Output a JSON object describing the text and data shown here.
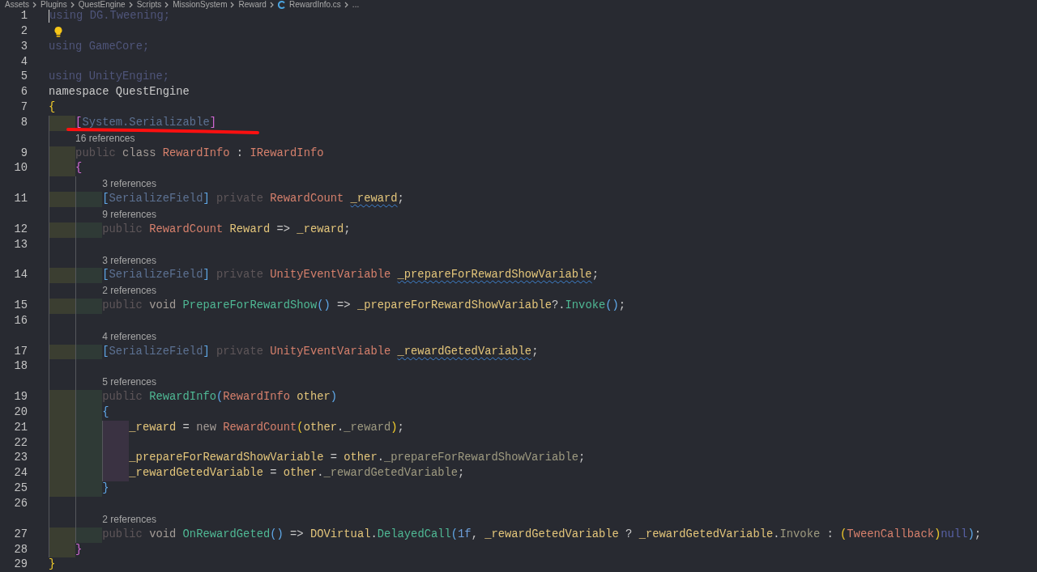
{
  "breadcrumbs": [
    {
      "label": "Assets",
      "kind": "folder"
    },
    {
      "label": "Plugins",
      "kind": "folder"
    },
    {
      "label": "QuestEngine",
      "kind": "folder"
    },
    {
      "label": "Scripts",
      "kind": "folder"
    },
    {
      "label": "MissionSystem",
      "kind": "folder"
    },
    {
      "label": "Reward",
      "kind": "folder"
    },
    {
      "label": "RewardInfo.cs",
      "kind": "file"
    },
    {
      "label": "...",
      "kind": "more"
    }
  ],
  "lines": [
    {
      "number": "1",
      "cursor": true,
      "tokens": [
        {
          "text": "using DG.Tweening;",
          "kind": "unused"
        }
      ]
    },
    {
      "number": "2",
      "lightbulb": true
    },
    {
      "number": "3",
      "tokens": [
        {
          "text": "using GameCore;",
          "kind": "unused"
        }
      ]
    },
    {
      "number": "4"
    },
    {
      "number": "5",
      "tokens": [
        {
          "text": "using UnityEngine;",
          "kind": "unused"
        }
      ]
    },
    {
      "number": "6",
      "tokens": [
        {
          "text": "namespace QuestEngine",
          "kind": "plain"
        }
      ]
    },
    {
      "number": "7",
      "tokens": [
        {
          "text": "{",
          "kind": "brace1"
        }
      ]
    },
    {
      "number": "8",
      "underlined": true,
      "guides": [
        {
          "shaded": true
        }
      ],
      "tokens": [
        {
          "text": "[",
          "kind": "brace2"
        },
        {
          "text": "System.Serializable",
          "kind": "attribute"
        },
        {
          "text": "]",
          "kind": "brace2"
        }
      ]
    },
    {
      "number": "9",
      "lens": "16 references",
      "guides": [
        {
          "shaded": true
        }
      ],
      "tokens": [
        {
          "text": "public ",
          "kind": "modifier"
        },
        {
          "text": "class ",
          "kind": "keyword"
        },
        {
          "text": "RewardInfo",
          "kind": "type"
        },
        {
          "text": " : ",
          "kind": "plain"
        },
        {
          "text": "IRewardInfo",
          "kind": "type"
        }
      ]
    },
    {
      "number": "10",
      "guides": [
        {
          "shaded": true
        }
      ],
      "tokens": [
        {
          "text": "{",
          "kind": "brace2"
        }
      ]
    },
    {
      "number": "11",
      "lens": "3 references",
      "guides": [
        {
          "shaded": true
        },
        {
          "shaded": true
        }
      ],
      "tokens": [
        {
          "text": "[",
          "kind": "brace3"
        },
        {
          "text": "SerializeField",
          "kind": "attribute"
        },
        {
          "text": "]",
          "kind": "brace3"
        },
        {
          "text": " private ",
          "kind": "modifier"
        },
        {
          "text": "RewardCount ",
          "kind": "type"
        },
        {
          "text": "_reward",
          "kind": "warning"
        },
        {
          "text": ";",
          "kind": "plain"
        }
      ]
    },
    {
      "number": "12",
      "lens": "9 references",
      "guides": [
        {
          "shaded": true
        },
        {
          "shaded": true
        }
      ],
      "tokens": [
        {
          "text": "public ",
          "kind": "modifier"
        },
        {
          "text": "RewardCount ",
          "kind": "type"
        },
        {
          "text": "Reward",
          "kind": "field"
        },
        {
          "text": " => ",
          "kind": "plain"
        },
        {
          "text": "_reward",
          "kind": "field"
        },
        {
          "text": ";",
          "kind": "plain"
        }
      ]
    },
    {
      "number": "13",
      "guides": [
        {
          "shaded": false
        },
        {
          "shaded": false
        }
      ]
    },
    {
      "number": "14",
      "lens": "3 references",
      "guides": [
        {
          "shaded": true
        },
        {
          "shaded": true
        }
      ],
      "tokens": [
        {
          "text": "[",
          "kind": "brace3"
        },
        {
          "text": "SerializeField",
          "kind": "attribute"
        },
        {
          "text": "]",
          "kind": "brace3"
        },
        {
          "text": " private ",
          "kind": "modifier"
        },
        {
          "text": "UnityEventVariable ",
          "kind": "type"
        },
        {
          "text": "_prepareForRewardShowVariable",
          "kind": "warning"
        },
        {
          "text": ";",
          "kind": "plain"
        }
      ]
    },
    {
      "number": "15",
      "lens": "2 references",
      "guides": [
        {
          "shaded": true
        },
        {
          "shaded": true
        }
      ],
      "tokens": [
        {
          "text": "public ",
          "kind": "modifier"
        },
        {
          "text": "void ",
          "kind": "keyword"
        },
        {
          "text": "PrepareForRewardShow",
          "kind": "method"
        },
        {
          "text": "()",
          "kind": "brace3"
        },
        {
          "text": " => ",
          "kind": "plain"
        },
        {
          "text": "_prepareForRewardShowVariable",
          "kind": "field"
        },
        {
          "text": "?.",
          "kind": "plain"
        },
        {
          "text": "Invoke",
          "kind": "method"
        },
        {
          "text": "()",
          "kind": "brace3"
        },
        {
          "text": ";",
          "kind": "plain"
        }
      ]
    },
    {
      "number": "16",
      "guides": [
        {
          "shaded": false
        },
        {
          "shaded": false
        }
      ]
    },
    {
      "number": "17",
      "lens": "4 references",
      "guides": [
        {
          "shaded": true
        },
        {
          "shaded": true
        }
      ],
      "tokens": [
        {
          "text": "[",
          "kind": "brace3"
        },
        {
          "text": "SerializeField",
          "kind": "attribute"
        },
        {
          "text": "]",
          "kind": "brace3"
        },
        {
          "text": " private ",
          "kind": "modifier"
        },
        {
          "text": "UnityEventVariable ",
          "kind": "type"
        },
        {
          "text": "_rewardGetedVariable",
          "kind": "warning"
        },
        {
          "text": ";",
          "kind": "plain"
        }
      ]
    },
    {
      "number": "18",
      "guides": [
        {
          "shaded": false
        },
        {
          "shaded": false
        }
      ]
    },
    {
      "number": "19",
      "lens": "5 references",
      "guides": [
        {
          "shaded": true
        },
        {
          "shaded": true
        }
      ],
      "tokens": [
        {
          "text": "public ",
          "kind": "modifier"
        },
        {
          "text": "RewardInfo",
          "kind": "method"
        },
        {
          "text": "(",
          "kind": "brace3"
        },
        {
          "text": "RewardInfo ",
          "kind": "type"
        },
        {
          "text": "other",
          "kind": "field"
        },
        {
          "text": ")",
          "kind": "brace3"
        }
      ]
    },
    {
      "number": "20",
      "guides": [
        {
          "shaded": true
        },
        {
          "shaded": true
        }
      ],
      "tokens": [
        {
          "text": "{",
          "kind": "brace3"
        }
      ]
    },
    {
      "number": "21",
      "guides": [
        {
          "shaded": true
        },
        {
          "shaded": true
        },
        {
          "shaded": true
        }
      ],
      "tokens": [
        {
          "text": "_reward",
          "kind": "field"
        },
        {
          "text": " = ",
          "kind": "plain"
        },
        {
          "text": "new ",
          "kind": "keyword"
        },
        {
          "text": "RewardCount",
          "kind": "type"
        },
        {
          "text": "(",
          "kind": "brace1"
        },
        {
          "text": "other",
          "kind": "field"
        },
        {
          "text": ".",
          "kind": "plain"
        },
        {
          "text": "_reward",
          "kind": "member"
        },
        {
          "text": ")",
          "kind": "brace1"
        },
        {
          "text": ";",
          "kind": "plain"
        }
      ]
    },
    {
      "number": "22",
      "guides": [
        {
          "shaded": true
        },
        {
          "shaded": true
        },
        {
          "shaded": true
        }
      ]
    },
    {
      "number": "23",
      "guides": [
        {
          "shaded": true
        },
        {
          "shaded": true
        },
        {
          "shaded": true
        }
      ],
      "tokens": [
        {
          "text": "_prepareForRewardShowVariable",
          "kind": "field"
        },
        {
          "text": " = ",
          "kind": "plain"
        },
        {
          "text": "other",
          "kind": "field"
        },
        {
          "text": ".",
          "kind": "plain"
        },
        {
          "text": "_prepareForRewardShowVariable",
          "kind": "member"
        },
        {
          "text": ";",
          "kind": "plain"
        }
      ]
    },
    {
      "number": "24",
      "guides": [
        {
          "shaded": true
        },
        {
          "shaded": true
        },
        {
          "shaded": true
        }
      ],
      "tokens": [
        {
          "text": "_rewardGetedVariable",
          "kind": "field"
        },
        {
          "text": " = ",
          "kind": "plain"
        },
        {
          "text": "other",
          "kind": "field"
        },
        {
          "text": ".",
          "kind": "plain"
        },
        {
          "text": "_rewardGetedVariable",
          "kind": "member"
        },
        {
          "text": ";",
          "kind": "plain"
        }
      ]
    },
    {
      "number": "25",
      "guides": [
        {
          "shaded": true
        },
        {
          "shaded": true
        }
      ],
      "tokens": [
        {
          "text": "}",
          "kind": "brace3"
        }
      ]
    },
    {
      "number": "26",
      "guides": [
        {
          "shaded": false
        },
        {
          "shaded": false
        }
      ]
    },
    {
      "number": "27",
      "lens": "2 references",
      "guides": [
        {
          "shaded": true
        },
        {
          "shaded": true
        }
      ],
      "tokens": [
        {
          "text": "public ",
          "kind": "modifier"
        },
        {
          "text": "void ",
          "kind": "keyword"
        },
        {
          "text": "OnRewardGeted",
          "kind": "method"
        },
        {
          "text": "()",
          "kind": "brace3"
        },
        {
          "text": " => ",
          "kind": "plain"
        },
        {
          "text": "DOVirtual",
          "kind": "field"
        },
        {
          "text": ".",
          "kind": "plain"
        },
        {
          "text": "DelayedCall",
          "kind": "method"
        },
        {
          "text": "(",
          "kind": "brace3"
        },
        {
          "text": "1f",
          "kind": "number"
        },
        {
          "text": ", ",
          "kind": "plain"
        },
        {
          "text": "_rewardGetedVariable",
          "kind": "field"
        },
        {
          "text": " ? ",
          "kind": "plain"
        },
        {
          "text": "_rewardGetedVariable",
          "kind": "field"
        },
        {
          "text": ".",
          "kind": "plain"
        },
        {
          "text": "Invoke",
          "kind": "member"
        },
        {
          "text": " : ",
          "kind": "plain"
        },
        {
          "text": "(",
          "kind": "brace1"
        },
        {
          "text": "TweenCallback",
          "kind": "type"
        },
        {
          "text": ")",
          "kind": "brace1"
        },
        {
          "text": "null",
          "kind": "literal"
        },
        {
          "text": ")",
          "kind": "brace3"
        },
        {
          "text": ";",
          "kind": "plain"
        }
      ]
    },
    {
      "number": "28",
      "guides": [
        {
          "shaded": true
        }
      ],
      "tokens": [
        {
          "text": "}",
          "kind": "brace2"
        }
      ]
    },
    {
      "number": "29",
      "tokens": [
        {
          "text": "}",
          "kind": "brace1"
        }
      ]
    }
  ]
}
